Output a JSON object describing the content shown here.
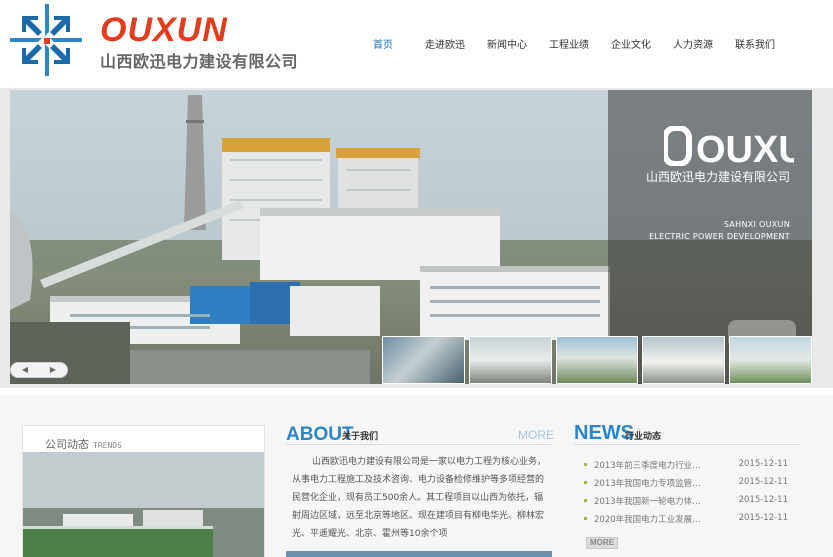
{
  "header": {
    "brand": "OUXUN",
    "company": "山西欧迅电力建设有限公司",
    "nav": [
      "首页",
      "走进欧迅",
      "新闻中心",
      "工程业绩",
      "企业文化",
      "人力资源",
      "联系我们"
    ]
  },
  "banner": {
    "logo_text": "OUXUN",
    "company_cn": "山西欧迅电力建设有限公司",
    "en_line1": "SAHNXI OUXUN",
    "en_line2": "ELECTRIC POWER DEVELOPMENT",
    "thumbnail_count": 5
  },
  "company_news": {
    "title": "公司动态",
    "title_en": "TRENDS"
  },
  "about": {
    "title_en": "ABOUT",
    "title_cn": "关于我们",
    "more": "MORE",
    "text": "山西欧迅电力建设有限公司是一家以电力工程为核心业务，从事电力工程施工及技术咨询、电力设备检修维护等多项经营的民营化企业，现有员工500余人。其工程项目以山西为依托，辐射周边区域，远至北京等地区。现在建项目有柳电华光、柳林宏光、平遥耀光、北京、霍州等10余个项"
  },
  "news": {
    "title_en": "NEWS",
    "title_cn": "行业动态",
    "more": "MORE",
    "items": [
      {
        "title": "2013年前三季度电力行业…",
        "date": "2015-12-11"
      },
      {
        "title": "2013年我国电力专项监管…",
        "date": "2015-12-11"
      },
      {
        "title": "2013年我国新一轮电力体…",
        "date": "2015-12-11"
      },
      {
        "title": "2020年我国电力工业发展…",
        "date": "2015-12-11"
      }
    ]
  },
  "colors": {
    "brand_red": "#e33b1b",
    "accent_blue": "#2a86c6",
    "nav_active": "#1f74b8"
  }
}
